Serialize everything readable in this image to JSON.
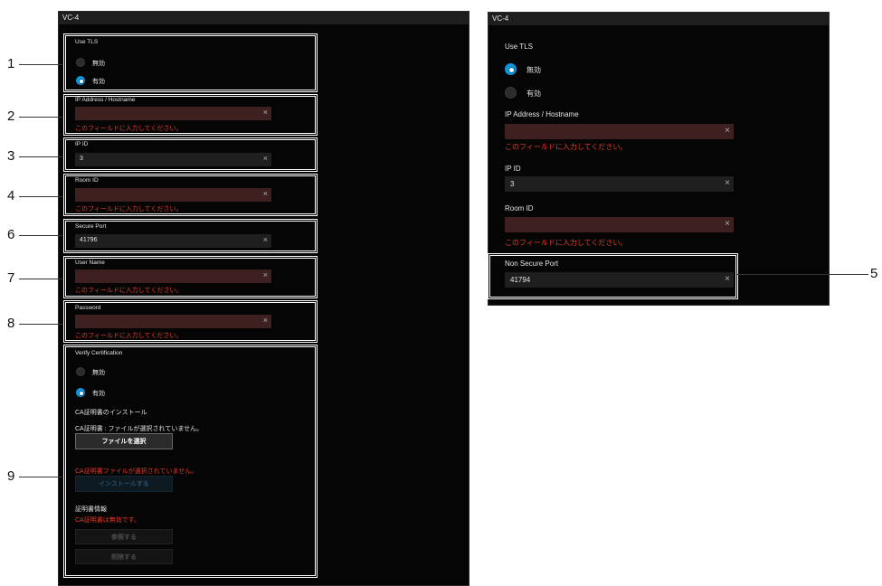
{
  "window_title": "VC-4",
  "left": {
    "use_tls": {
      "label": "Use TLS",
      "opt_off": "無効",
      "opt_on": "有効",
      "selected": "有効"
    },
    "ip": {
      "label": "IP Address / Hostname",
      "value": "",
      "error": "このフィールドに入力してください。"
    },
    "ipid": {
      "label": "IP ID",
      "value": "3"
    },
    "room": {
      "label": "Room ID",
      "value": "",
      "error": "このフィールドに入力してください。"
    },
    "secure_port": {
      "label": "Secure Port",
      "value": "41796"
    },
    "user": {
      "label": "User Name",
      "value": "",
      "error": "このフィールドに入力してください。"
    },
    "password": {
      "label": "Password",
      "value": "",
      "error": "このフィールドに入力してください。"
    },
    "verify": {
      "label": "Verify Certification",
      "opt_off": "無効",
      "opt_on": "有効",
      "selected": "有効",
      "ca_install_title": "CA証明書のインストール",
      "ca_file_status": "CA証明書 : ファイルが選択されていません。",
      "choose_file_button": "ファイルを選択",
      "ca_file_error": "CA証明書ファイルが選択されていません。",
      "install_button": "インストールする",
      "cert_info_title": "証明書情報",
      "cert_invalid": "CA証明書は無効です。",
      "view_button": "参照する",
      "delete_button": "削除する"
    }
  },
  "right": {
    "use_tls": {
      "label": "Use TLS",
      "opt_off": "無効",
      "opt_on": "有効",
      "selected": "無効"
    },
    "ip": {
      "label": "IP Address / Hostname",
      "value": "",
      "error": "このフィールドに入力してください。"
    },
    "ipid": {
      "label": "IP ID",
      "value": "3"
    },
    "room": {
      "label": "Room ID",
      "value": "",
      "error": "このフィールドに入力してください。"
    },
    "non_secure_port": {
      "label": "Non Secure Port",
      "value": "41794"
    }
  },
  "clear_glyph": "×",
  "callouts": [
    "1",
    "2",
    "3",
    "4",
    "6",
    "7",
    "8",
    "9",
    "5"
  ],
  "colors": {
    "error": "#e83a2a",
    "radio_selected": "#0e97e0",
    "error_field": "#3e2020"
  }
}
